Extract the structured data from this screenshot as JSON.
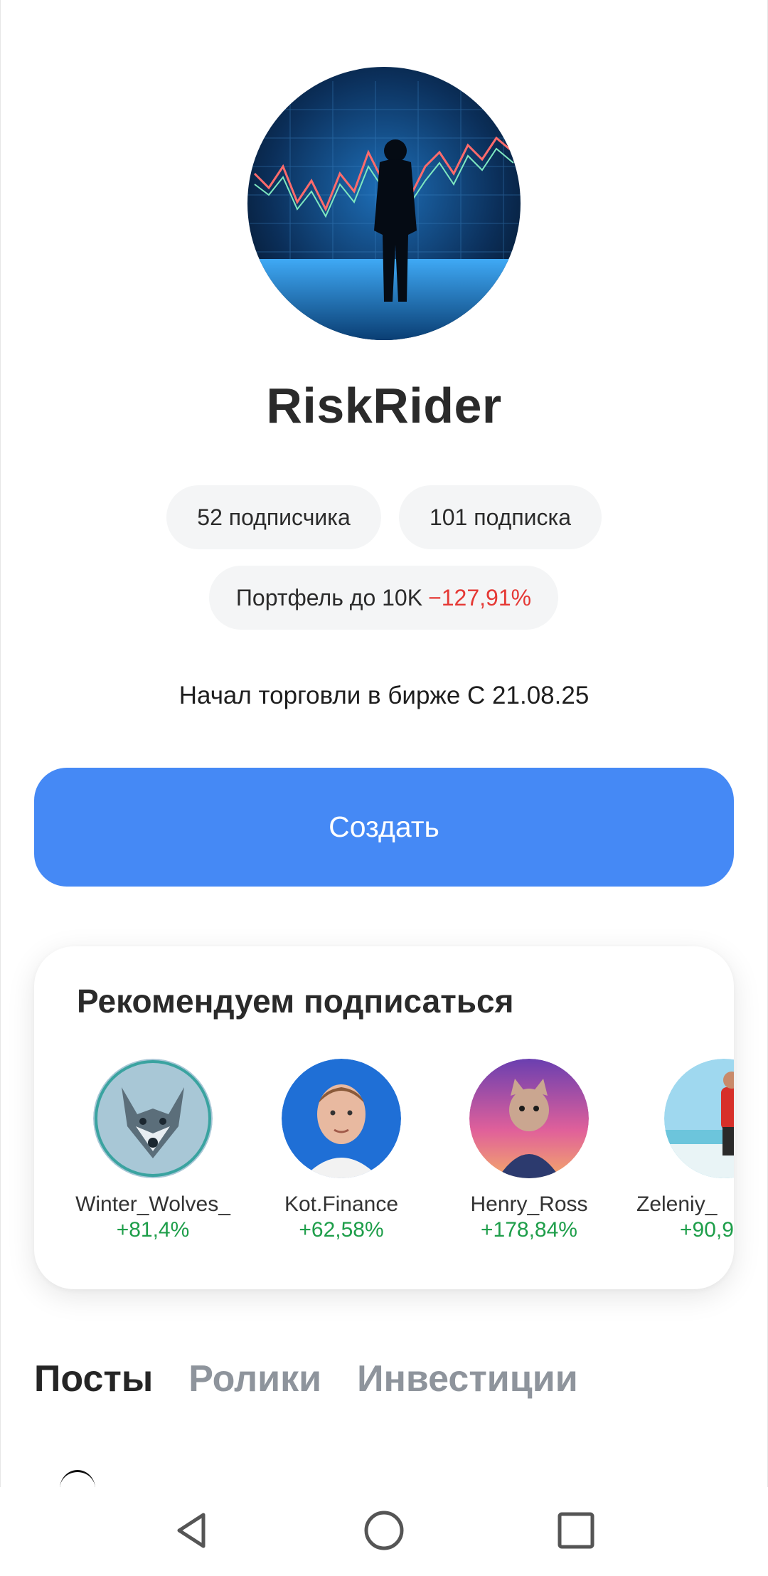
{
  "profile": {
    "username": "RiskRider",
    "avatar_icon": "trader-chart-avatar",
    "followers": "52 подписчика",
    "following": "101 подписка",
    "portfolio_label": "Портфель до 10K",
    "portfolio_change": "−127,91%",
    "bio": "Начал торговли в бирже С 21.08.25"
  },
  "actions": {
    "create_label": "Создать"
  },
  "recommendations": {
    "title": "Рекомендуем подписаться",
    "items": [
      {
        "name": "Winter_Wolves_",
        "gain": "+81,4%",
        "avatar_icon": "wolf-avatar"
      },
      {
        "name": "Kot.Finance",
        "gain": "+62,58%",
        "avatar_icon": "person-avatar"
      },
      {
        "name": "Henry_Ross",
        "gain": "+178,84%",
        "avatar_icon": "cat-avatar"
      },
      {
        "name": "Zeleniy_",
        "gain": "+90,9",
        "avatar_icon": "beach-avatar"
      }
    ]
  },
  "tabs": [
    {
      "label": "Посты",
      "active": true
    },
    {
      "label": "Ролики",
      "active": false
    },
    {
      "label": "Инвестиции",
      "active": false
    }
  ],
  "colors": {
    "accent": "#4589f5",
    "negative": "#e53935",
    "positive": "#1e9e4a"
  },
  "navbar": {
    "icons": [
      "back-icon",
      "home-icon",
      "recents-icon"
    ]
  }
}
